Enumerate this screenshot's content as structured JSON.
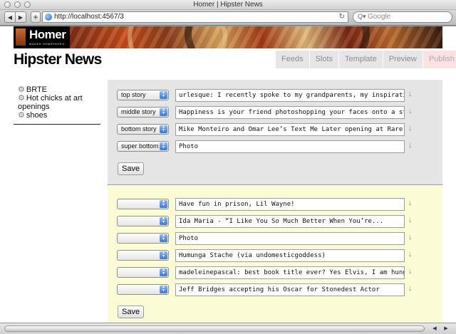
{
  "window": {
    "title": "Homer | Hipster News"
  },
  "browser": {
    "url": "http://localhost:4567/3",
    "search_placeholder": "Google",
    "back_glyph": "◀",
    "forward_glyph": "▶",
    "add_glyph": "+",
    "reload_glyph": "↻",
    "search_glyph": "Q▾"
  },
  "logo": {
    "title": "Homer",
    "subtitle": "MAKES HOMEPAGES"
  },
  "site": {
    "title": "Hipster News"
  },
  "nav": {
    "tabs": [
      {
        "label": "Feeds"
      },
      {
        "label": "Slots"
      },
      {
        "label": "Template"
      },
      {
        "label": "Preview"
      },
      {
        "label": "Publish"
      }
    ]
  },
  "sidebar": {
    "items": [
      {
        "label": "BRTE"
      },
      {
        "label": "Hot chicks at art openings"
      },
      {
        "label": "shoes"
      }
    ]
  },
  "icons": {
    "gear": "gear-icon",
    "down_arrow": "↓",
    "select_arrows": "▴▾"
  },
  "assigned": {
    "rows": [
      {
        "slot": "top story",
        "headline": "urlesque:   I recently spoke to my grandparents, my inspiration"
      },
      {
        "slot": "middle story",
        "headline": "Happiness is your friend photoshopping your faces onto a still"
      },
      {
        "slot": "bottom story",
        "headline": "Mike Monteiro and Omar Lee’s Text Me Later opening at Rare..."
      },
      {
        "slot": "super bottom",
        "headline": "Photo"
      }
    ],
    "save_label": "Save"
  },
  "unassigned": {
    "rows": [
      {
        "slot": "",
        "headline": "Have fun in prison, Lil Wayne!"
      },
      {
        "slot": "",
        "headline": "Ida Maria - “I Like You So Much Better When You’re..."
      },
      {
        "slot": "",
        "headline": "Photo"
      },
      {
        "slot": "",
        "headline": "Humunga Stache (via undomesticgoddess)"
      },
      {
        "slot": "",
        "headline": "madeleinepascal:  best book title ever?  Yes Elvis, I am hungry"
      },
      {
        "slot": "",
        "headline": "Jeff Bridges accepting his Oscar for Stonedest Actor"
      }
    ],
    "save_label": "Save"
  }
}
